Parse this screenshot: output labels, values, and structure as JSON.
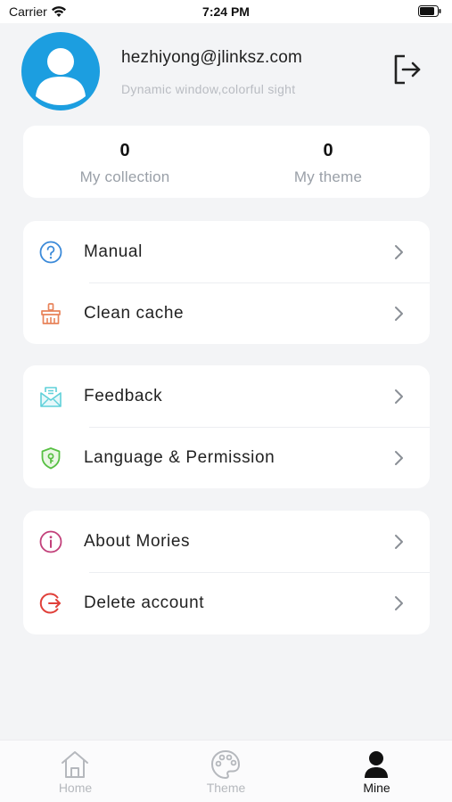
{
  "status_bar": {
    "carrier": "Carrier",
    "time": "7:24 PM"
  },
  "profile": {
    "email": "hezhiyong@jlinksz.com",
    "tagline": "Dynamic window,colorful sight"
  },
  "stats": [
    {
      "value": "0",
      "label": "My collection"
    },
    {
      "value": "0",
      "label": "My theme"
    }
  ],
  "menu": {
    "manual": {
      "label": "Manual",
      "icon": "question-circle-icon",
      "color": "#3b8ad9"
    },
    "clean_cache": {
      "label": "Clean cache",
      "icon": "broom-icon",
      "color": "#e8835a"
    },
    "feedback": {
      "label": "Feedback",
      "icon": "mail-icon",
      "color": "#5fd0d9"
    },
    "language": {
      "label": "Language & Permission",
      "icon": "shield-icon",
      "color": "#57c043"
    },
    "about": {
      "label": "About Mories",
      "icon": "info-circle-icon",
      "color": "#c2407a"
    },
    "delete": {
      "label": "Delete account",
      "icon": "exit-circle-icon",
      "color": "#e0403a"
    }
  },
  "tabs": [
    {
      "label": "Home",
      "icon": "home-icon"
    },
    {
      "label": "Theme",
      "icon": "palette-icon"
    },
    {
      "label": "Mine",
      "icon": "person-icon",
      "active": true
    }
  ],
  "colors": {
    "background": "#f3f4f6",
    "avatar": "#1c9ee0",
    "inactive": "#b5b8bd",
    "active": "#111111"
  }
}
